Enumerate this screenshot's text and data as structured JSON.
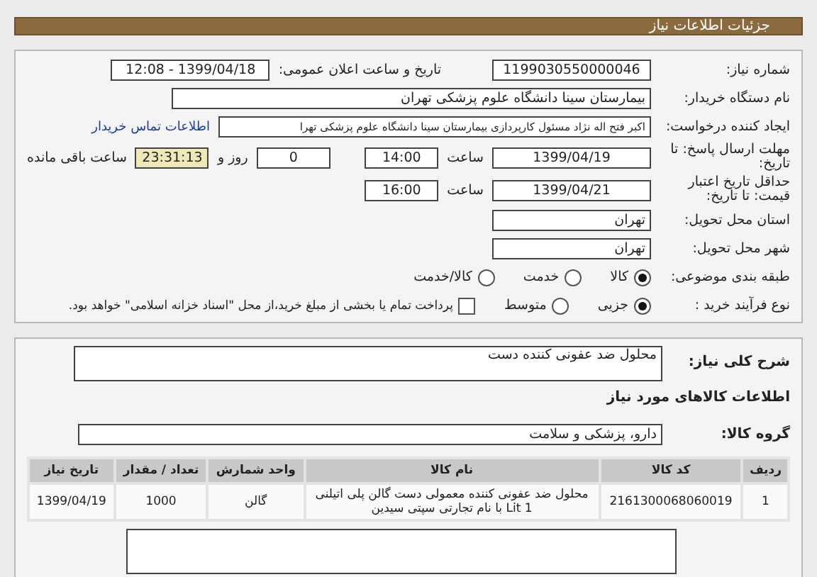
{
  "header": {
    "title": "جزئیات اطلاعات نیاز"
  },
  "need_number": {
    "label": "شماره نیاز:",
    "value": "1199030550000046"
  },
  "announce": {
    "label": "تاریخ و ساعت اعلان عمومی:",
    "value": "1399/04/18 - 12:08"
  },
  "buyer": {
    "label": "نام دستگاه خریدار:",
    "value": "بیمارستان سینا دانشگاه علوم پزشکی تهران"
  },
  "creator": {
    "label": "ایجاد کننده درخواست:",
    "value": "اکبر  فتح اله نژاد  مسئول کارپردازی  بیمارستان سینا دانشگاه علوم پزشکی تهرا",
    "link": "اطلاعات تماس خریدار"
  },
  "deadline": {
    "label": "مهلت ارسال پاسخ: تا تاریخ:",
    "date": "1399/04/19",
    "time_label": "ساعت",
    "time": "14:00",
    "days": "0",
    "days_label": "روز و",
    "remaining": "23:31:13",
    "remaining_label": "ساعت باقی مانده"
  },
  "validity": {
    "label": "حداقل تاریخ اعتبار قیمت: تا تاریخ:",
    "date": "1399/04/21",
    "time_label": "ساعت",
    "time": "16:00"
  },
  "province": {
    "label": "استان محل تحویل:",
    "value": "تهران"
  },
  "city": {
    "label": "شهر محل تحویل:",
    "value": "تهران"
  },
  "category": {
    "label": "طبقه بندی موضوعی:",
    "options": [
      {
        "label": "کالا",
        "selected": true
      },
      {
        "label": "خدمت",
        "selected": false
      },
      {
        "label": "کالا/خدمت",
        "selected": false
      }
    ]
  },
  "purchase_type": {
    "label": "نوع فرآیند خرید :",
    "options": [
      {
        "label": "جزیی",
        "selected": true
      },
      {
        "label": "متوسط",
        "selected": false
      }
    ],
    "checkbox": {
      "checked": false,
      "label": "پرداخت تمام یا بخشی از مبلغ خرید،از محل \"اسناد خزانه اسلامی\" خواهد بود."
    }
  },
  "description": {
    "label": "شرح کلی نیاز:",
    "value": "محلول ضد عفونی کننده دست"
  },
  "goods_heading": "اطلاعات کالاهای مورد نیاز",
  "goods_group": {
    "label": "گروه کالا:",
    "value": "دارو، پزشکی و سلامت"
  },
  "table": {
    "columns": [
      "ردیف",
      "کد کالا",
      "نام کالا",
      "واحد شمارش",
      "تعداد / مقدار",
      "تاریخ نیاز"
    ],
    "rows": [
      [
        "1",
        "2161300068060019",
        "محلول ضد عفونی کننده معمولی دست گالن پلی اتیلنی 1 Lit با نام تجارتی سپتی سیدین",
        "گالن",
        "1000",
        "1399/04/19"
      ]
    ]
  }
}
